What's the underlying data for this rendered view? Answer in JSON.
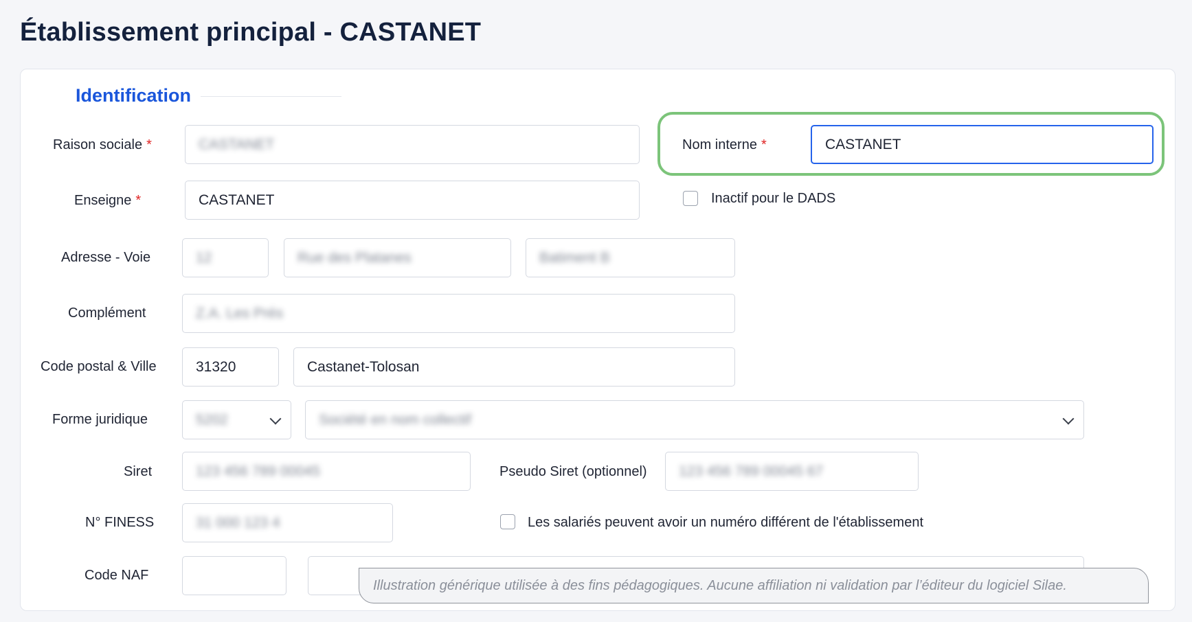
{
  "page_title": "Établissement principal - CASTANET",
  "section": {
    "title": "Identification"
  },
  "fields": {
    "raison_sociale": {
      "label": "Raison sociale",
      "value": "CASTANET"
    },
    "nom_interne": {
      "label": "Nom interne",
      "value": "CASTANET"
    },
    "enseigne": {
      "label": "Enseigne",
      "value": "CASTANET"
    },
    "inactif_dads": {
      "label": "Inactif pour le DADS",
      "checked": false
    },
    "adresse_voie": {
      "label": "Adresse - Voie",
      "numero": "12",
      "voie": "Rue des Platanes",
      "batiment": "Batiment B"
    },
    "complement": {
      "label": "Complément",
      "value": "Z.A. Les Prés"
    },
    "code_postal_ville": {
      "label": "Code postal & Ville",
      "code_postal": "31320",
      "ville": "Castanet-Tolosan"
    },
    "forme_juridique": {
      "label": "Forme juridique",
      "code": "5202",
      "libelle": "Société en nom collectif"
    },
    "siret": {
      "label": "Siret",
      "value": "123 456 789 00045"
    },
    "pseudo_siret": {
      "label": "Pseudo Siret (optionnel)",
      "value": "123 456 789 00045 67"
    },
    "finess": {
      "label": "N° FINESS",
      "value": "31 000 123 4"
    },
    "numero_different": {
      "label": "Les salariés peuvent avoir un numéro différent de l'établissement",
      "checked": false
    },
    "code_naf": {
      "label": "Code NAF",
      "code": "",
      "libelle": ""
    }
  },
  "required_marker": "*",
  "disclaimer": "Illustration générique utilisée à des fins pédagogiques. Aucune affiliation ni validation par l’éditeur du logiciel Silae.",
  "colors": {
    "accent": "#1a56db",
    "highlight": "#7cc47a",
    "required": "#e02424",
    "focus_border": "#2563eb"
  }
}
